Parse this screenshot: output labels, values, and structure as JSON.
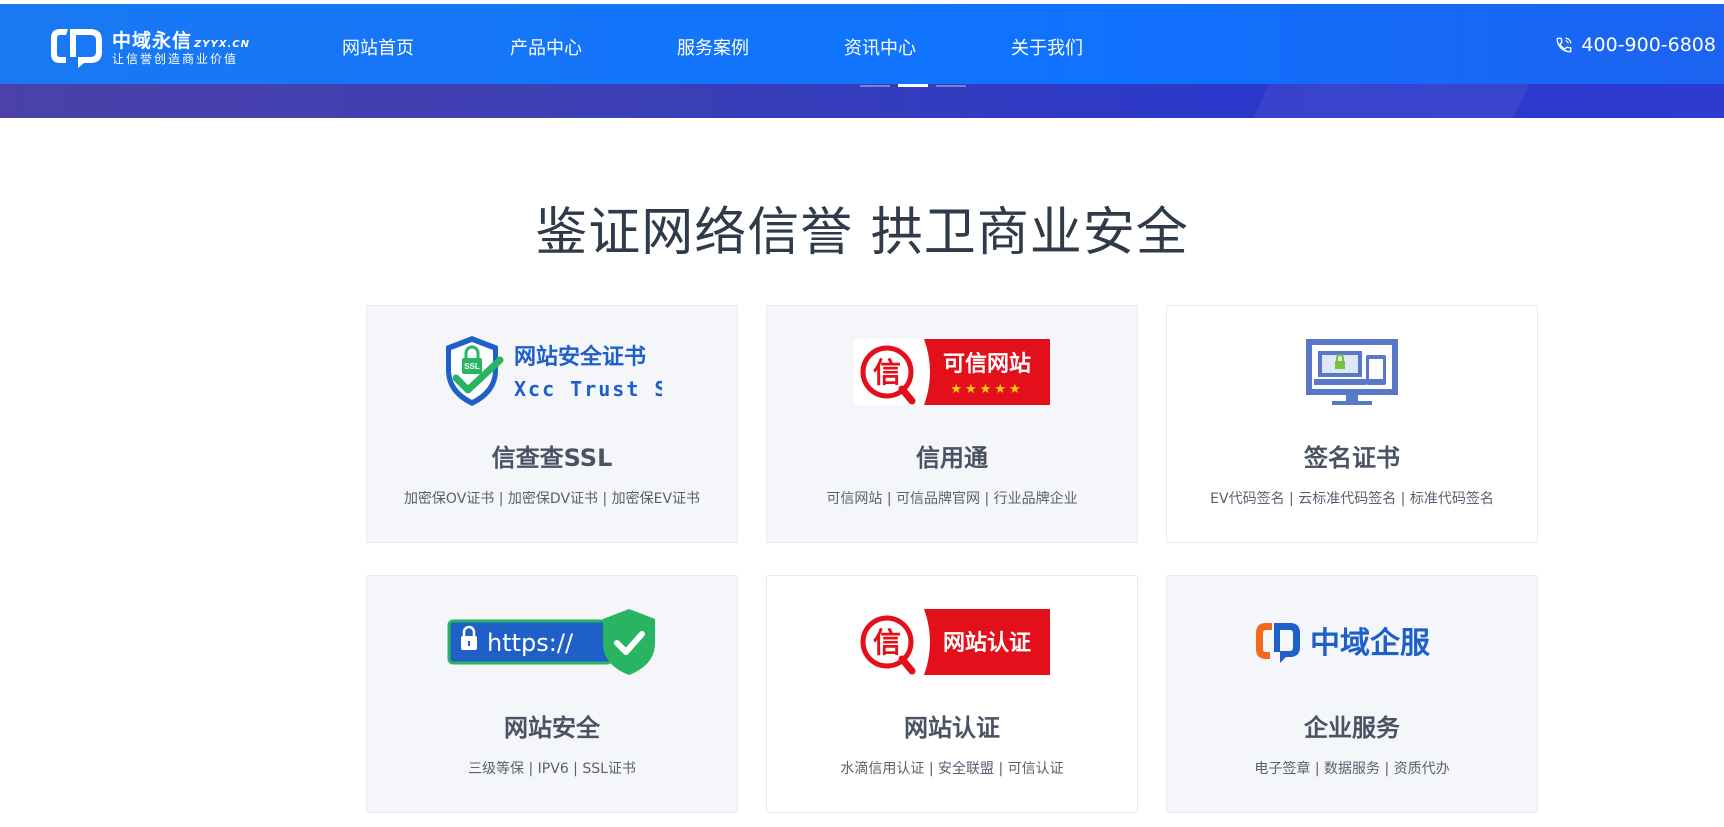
{
  "header": {
    "logo_title": "中域永信",
    "logo_domain": "ZYYX.CN",
    "logo_slogan": "让信誉创造商业价值",
    "nav": [
      "网站首页",
      "产品中心",
      "服务案例",
      "资讯中心",
      "关于我们"
    ],
    "phone": "400-900-6808",
    "phone_icon": "phone-icon"
  },
  "carousel": {
    "slides": 3,
    "active": 2
  },
  "main": {
    "headline": "鉴证网络信誉 拱卫商业安全",
    "cards": [
      {
        "title": "信查查SSL",
        "desc": "加密保OV证书 | 加密保DV证书 | 加密保EV证书",
        "logo_line1": "网站安全证书",
        "logo_line2": "Xcc Trust SSL",
        "logo_badge": "SSL",
        "icon": "ssl-shield-icon"
      },
      {
        "title": "信用通",
        "desc": "可信网站 | 可信品牌官网 | 行业品牌企业",
        "logo_text": "可信网站",
        "logo_char": "信",
        "logo_stars": "★★★★★",
        "icon": "trusted-site-badge-icon"
      },
      {
        "title": "签名证书",
        "desc": "EV代码签名 | 云标准代码签名 | 标准代码签名",
        "icon": "secure-devices-icon"
      },
      {
        "title": "网站安全",
        "desc": "三级等保 | IPV6 | SSL证书",
        "logo_text": "https://",
        "icon": "https-shield-icon"
      },
      {
        "title": "网站认证",
        "desc": "水滴信用认证 | 安全联盟 | 可信认证",
        "logo_text": "网站认证",
        "logo_char": "信",
        "icon": "site-cert-badge-icon"
      },
      {
        "title": "企业服务",
        "desc": "电子签章 | 数据服务 | 资质代办",
        "logo_text": "中域企服",
        "icon": "zhongyu-qifu-logo-icon"
      }
    ]
  },
  "colors": {
    "header_blue": "#1677ff",
    "headline": "#2f3a4a",
    "card_bg": "#f4f6f9",
    "badge_red": "#e3101b",
    "ssl_blue": "#1e5fc8",
    "check_green": "#28b463",
    "device_blue": "#5a78c8",
    "qifu_orange": "#f26b1d"
  }
}
